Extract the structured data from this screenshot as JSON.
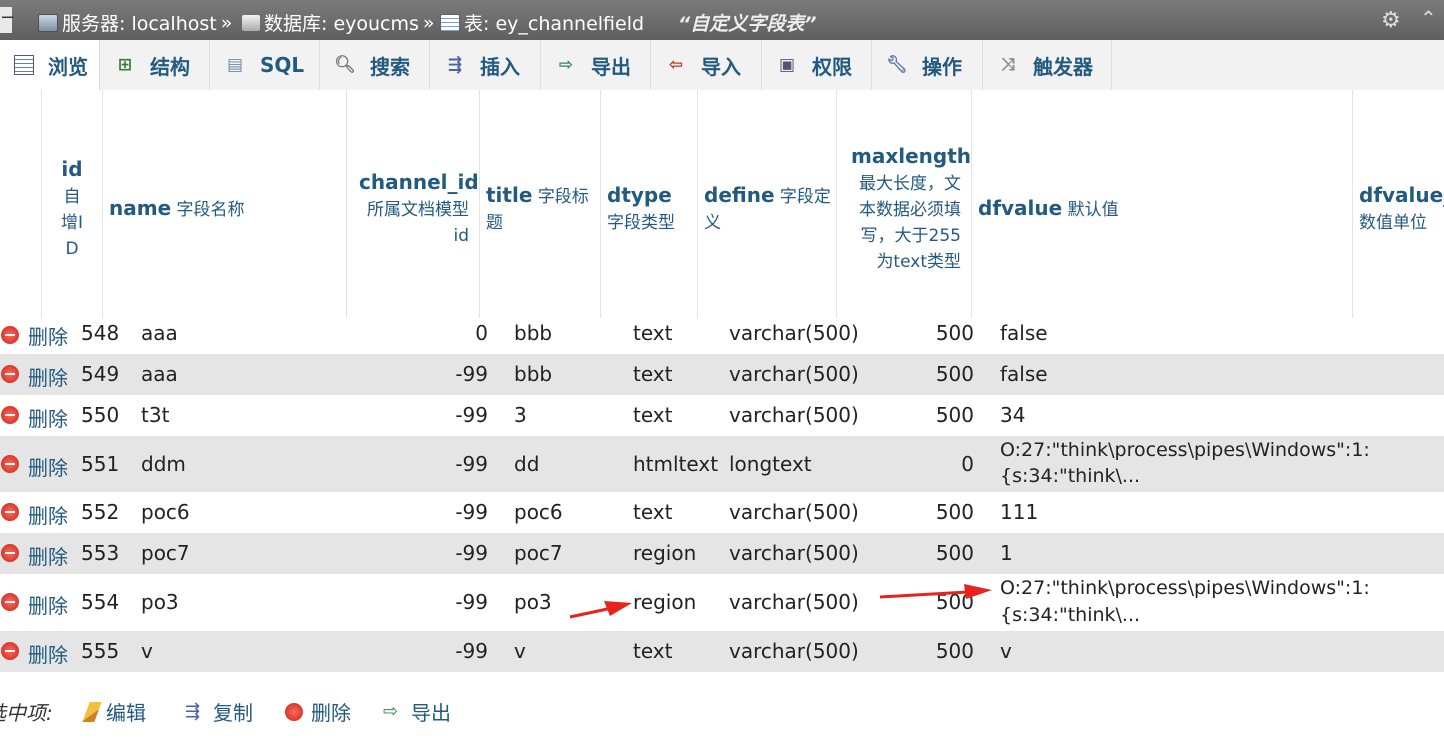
{
  "topbar": {
    "server": "服务器: localhost",
    "db": "数据库: eyoucms",
    "table": "表: ey_channelfield",
    "separator": "»",
    "table_comment": "“自定义字段表”"
  },
  "tabs": [
    {
      "label": "浏览",
      "icon": "browse-icon"
    },
    {
      "label": "结构",
      "icon": "structure-icon"
    },
    {
      "label": "SQL",
      "icon": "sql-icon"
    },
    {
      "label": "搜索",
      "icon": "search-icon"
    },
    {
      "label": "插入",
      "icon": "insert-icon"
    },
    {
      "label": "导出",
      "icon": "export-icon"
    },
    {
      "label": "导入",
      "icon": "import-icon"
    },
    {
      "label": "权限",
      "icon": "privileges-icon"
    },
    {
      "label": "操作",
      "icon": "operations-icon"
    },
    {
      "label": "触发器",
      "icon": "triggers-icon"
    }
  ],
  "columns": {
    "id": {
      "name": "id",
      "comment": "自增ID"
    },
    "name": {
      "name": "name",
      "comment": "字段名称"
    },
    "channel_id": {
      "name": "channel_id",
      "comment": "所属文档模型id"
    },
    "title": {
      "name": "title",
      "comment": "字段标题"
    },
    "dtype": {
      "name": "dtype",
      "comment": "字段类型"
    },
    "define": {
      "name": "define",
      "comment": "字段定义"
    },
    "maxlength": {
      "name": "maxlength",
      "comment": "最大长度，文本数据必须填写，大于255为text类型"
    },
    "dfvalue": {
      "name": "dfvalue",
      "comment": "默认值"
    },
    "dfvalue_unit": {
      "name": "dfvalue_",
      "comment": "数值单位"
    }
  },
  "delete_label": "删除",
  "rows": [
    {
      "id": "548",
      "name": "aaa",
      "channel_id": "0",
      "title": "bbb",
      "dtype": "text",
      "define": "varchar(500)",
      "maxlength": "500",
      "dfvalue": "false",
      "dfvalue2": ""
    },
    {
      "id": "549",
      "name": "aaa",
      "channel_id": "-99",
      "title": "bbb",
      "dtype": "text",
      "define": "varchar(500)",
      "maxlength": "500",
      "dfvalue": "false",
      "dfvalue2": ""
    },
    {
      "id": "550",
      "name": "t3t",
      "channel_id": "-99",
      "title": "3",
      "dtype": "text",
      "define": "varchar(500)",
      "maxlength": "500",
      "dfvalue": "34",
      "dfvalue2": ""
    },
    {
      "id": "551",
      "name": "ddm",
      "channel_id": "-99",
      "title": "dd",
      "dtype": "htmltext",
      "define": "longtext",
      "maxlength": "0",
      "dfvalue": "O:27:\"think\\process\\pipes\\Windows\":1:",
      "dfvalue2": "{s:34:\"think\\..."
    },
    {
      "id": "552",
      "name": "poc6",
      "channel_id": "-99",
      "title": "poc6",
      "dtype": "text",
      "define": "varchar(500)",
      "maxlength": "500",
      "dfvalue": "111",
      "dfvalue2": ""
    },
    {
      "id": "553",
      "name": "poc7",
      "channel_id": "-99",
      "title": "poc7",
      "dtype": "region",
      "define": "varchar(500)",
      "maxlength": "500",
      "dfvalue": "1",
      "dfvalue2": ""
    },
    {
      "id": "554",
      "name": "po3",
      "channel_id": "-99",
      "title": "po3",
      "dtype": "region",
      "define": "varchar(500)",
      "maxlength": "500",
      "dfvalue": "O:27:\"think\\process\\pipes\\Windows\":1:",
      "dfvalue2": "{s:34:\"think\\..."
    },
    {
      "id": "555",
      "name": "v",
      "channel_id": "-99",
      "title": "v",
      "dtype": "text",
      "define": "varchar(500)",
      "maxlength": "500",
      "dfvalue": "v",
      "dfvalue2": ""
    }
  ],
  "footer": {
    "label": "选中项:",
    "edit": "编辑",
    "copy": "复制",
    "delete": "删除",
    "export": "导出"
  },
  "colors": {
    "link": "#235a81",
    "arrow": "#e8231c",
    "row_alt": "#e5e5e5"
  }
}
